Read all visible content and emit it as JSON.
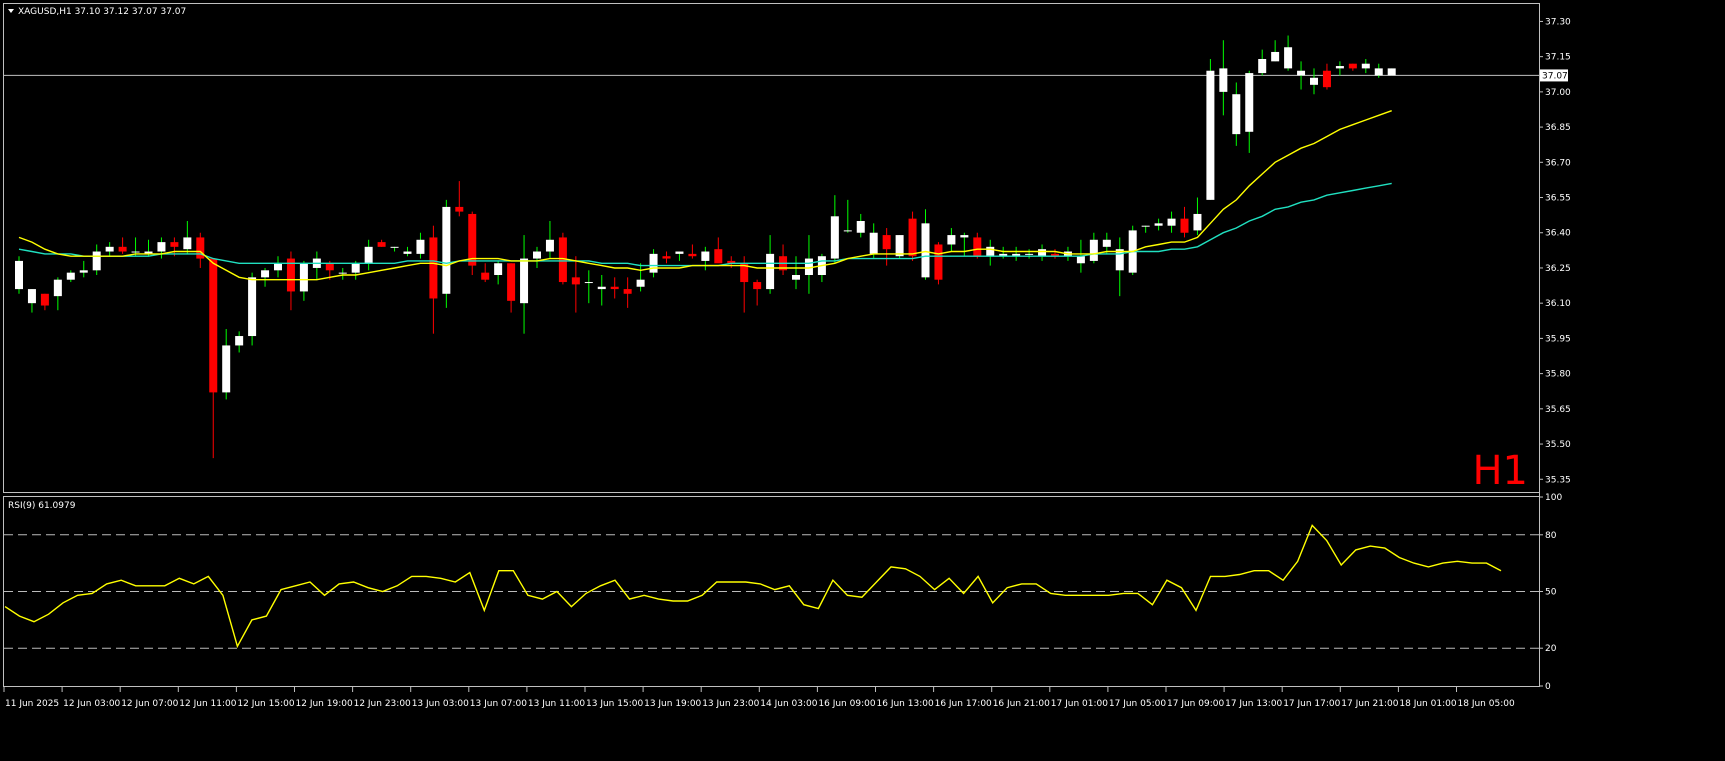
{
  "header": {
    "symbol_line": "XAGUSD,H1  37.10 37.12 37.07 37.07",
    "timeframe_watermark": "H1"
  },
  "rsi_panel": {
    "label": "RSI(9) 61.0979"
  },
  "colors": {
    "background": "#000000",
    "frame": "#c0c0c0",
    "bull_candle": "#ffffff",
    "bear_candle": "#ff0000",
    "wick_bull": "#00ff00",
    "wick_bear": "#ff0000",
    "ma_fast": "#ffff00",
    "ma_slow": "#20e0c0",
    "rsi_line": "#ffff00",
    "watermark": "#ff0000",
    "price_line": "#c0c0c0"
  },
  "chart_data": [
    {
      "type": "candlestick",
      "symbol": "XAGUSD",
      "timeframe": "H1",
      "last_price": 37.07,
      "last_price_label": "37.07",
      "y_ticks": [
        "37.30",
        "37.15",
        "37.00",
        "36.85",
        "36.70",
        "36.55",
        "36.40",
        "36.25",
        "36.10",
        "35.95",
        "35.80",
        "35.65",
        "35.50",
        "35.35"
      ],
      "ylim": [
        35.3,
        37.37
      ],
      "x_tick_labels": [
        "11 Jun 2025",
        "12 Jun 03:00",
        "12 Jun 07:00",
        "12 Jun 11:00",
        "12 Jun 15:00",
        "12 Jun 19:00",
        "12 Jun 23:00",
        "13 Jun 03:00",
        "13 Jun 07:00",
        "13 Jun 11:00",
        "13 Jun 15:00",
        "13 Jun 19:00",
        "13 Jun 23:00",
        "14 Jun 03:00",
        "16 Jun 09:00",
        "16 Jun 13:00",
        "16 Jun 17:00",
        "16 Jun 21:00",
        "17 Jun 01:00",
        "17 Jun 05:00",
        "17 Jun 09:00",
        "17 Jun 13:00",
        "17 Jun 17:00",
        "17 Jun 21:00",
        "18 Jun 01:00",
        "18 Jun 05:00"
      ],
      "ohlc": [
        [
          36.16,
          36.3,
          36.14,
          36.28
        ],
        [
          36.1,
          36.16,
          36.06,
          36.16
        ],
        [
          36.14,
          36.14,
          36.07,
          36.09
        ],
        [
          36.13,
          36.21,
          36.07,
          36.2
        ],
        [
          36.2,
          36.24,
          36.19,
          36.23
        ],
        [
          36.23,
          36.28,
          36.21,
          36.24
        ],
        [
          36.24,
          36.35,
          36.22,
          36.32
        ],
        [
          36.32,
          36.36,
          36.3,
          36.34
        ],
        [
          36.34,
          36.38,
          36.31,
          36.32
        ],
        [
          36.32,
          36.38,
          36.3,
          36.32
        ],
        [
          36.31,
          36.37,
          36.3,
          36.32
        ],
        [
          36.32,
          36.38,
          36.29,
          36.36
        ],
        [
          36.36,
          36.38,
          36.3,
          36.34
        ],
        [
          36.33,
          36.45,
          36.31,
          36.38
        ],
        [
          36.38,
          36.4,
          36.25,
          36.29
        ],
        [
          36.29,
          36.29,
          35.44,
          35.72
        ],
        [
          35.72,
          35.99,
          35.69,
          35.92
        ],
        [
          35.92,
          35.98,
          35.89,
          35.96
        ],
        [
          35.96,
          36.23,
          35.92,
          36.21
        ],
        [
          36.21,
          36.25,
          36.17,
          36.24
        ],
        [
          36.24,
          36.3,
          36.21,
          36.27
        ],
        [
          36.29,
          36.32,
          36.07,
          36.15
        ],
        [
          36.15,
          36.28,
          36.11,
          36.27
        ],
        [
          36.25,
          36.32,
          36.2,
          36.29
        ],
        [
          36.27,
          36.28,
          36.2,
          36.24
        ],
        [
          36.23,
          36.25,
          36.2,
          36.23
        ],
        [
          36.23,
          36.28,
          36.2,
          36.27
        ],
        [
          36.27,
          36.37,
          36.24,
          36.34
        ],
        [
          36.36,
          36.37,
          36.34,
          36.34
        ],
        [
          36.34,
          36.34,
          36.32,
          36.34
        ],
        [
          36.31,
          36.34,
          36.3,
          36.32
        ],
        [
          36.31,
          36.4,
          36.29,
          36.37
        ],
        [
          36.38,
          36.43,
          35.97,
          36.12
        ],
        [
          36.14,
          36.54,
          36.08,
          36.51
        ],
        [
          36.51,
          36.62,
          36.47,
          36.49
        ],
        [
          36.48,
          36.49,
          36.22,
          36.26
        ],
        [
          36.23,
          36.27,
          36.19,
          36.2
        ],
        [
          36.22,
          36.28,
          36.18,
          36.27
        ],
        [
          36.27,
          36.27,
          36.06,
          36.11
        ],
        [
          36.1,
          36.39,
          35.97,
          36.29
        ],
        [
          36.29,
          36.34,
          36.25,
          36.32
        ],
        [
          36.32,
          36.45,
          36.29,
          36.37
        ],
        [
          36.38,
          36.4,
          36.18,
          36.19
        ],
        [
          36.21,
          36.3,
          36.06,
          36.18
        ],
        [
          36.19,
          36.24,
          36.1,
          36.19
        ],
        [
          36.16,
          36.22,
          36.09,
          36.17
        ],
        [
          36.17,
          36.21,
          36.12,
          36.16
        ],
        [
          36.16,
          36.21,
          36.08,
          36.14
        ],
        [
          36.17,
          36.27,
          36.15,
          36.2
        ],
        [
          36.23,
          36.33,
          36.21,
          36.31
        ],
        [
          36.3,
          36.32,
          36.27,
          36.29
        ],
        [
          36.31,
          36.32,
          36.28,
          36.32
        ],
        [
          36.31,
          36.35,
          36.29,
          36.3
        ],
        [
          36.28,
          36.34,
          36.24,
          36.32
        ],
        [
          36.33,
          36.38,
          36.28,
          36.27
        ],
        [
          36.28,
          36.3,
          36.25,
          36.27
        ],
        [
          36.27,
          36.3,
          36.06,
          36.19
        ],
        [
          36.19,
          36.2,
          36.09,
          36.16
        ],
        [
          36.16,
          36.39,
          36.14,
          36.31
        ],
        [
          36.3,
          36.35,
          36.22,
          36.24
        ],
        [
          36.2,
          36.3,
          36.16,
          36.22
        ],
        [
          36.22,
          36.39,
          36.14,
          36.29
        ],
        [
          36.22,
          36.31,
          36.19,
          36.3
        ],
        [
          36.29,
          36.56,
          36.27,
          36.47
        ],
        [
          36.41,
          36.54,
          36.4,
          36.41
        ],
        [
          36.4,
          36.48,
          36.38,
          36.45
        ],
        [
          36.31,
          36.44,
          36.29,
          36.4
        ],
        [
          36.39,
          36.42,
          36.26,
          36.33
        ],
        [
          36.3,
          36.39,
          36.29,
          36.39
        ],
        [
          36.46,
          36.49,
          36.28,
          36.3
        ],
        [
          36.21,
          36.5,
          36.2,
          36.44
        ],
        [
          36.35,
          36.36,
          36.18,
          36.2
        ],
        [
          36.35,
          36.42,
          36.32,
          36.39
        ],
        [
          36.38,
          36.4,
          36.3,
          36.39
        ],
        [
          36.38,
          36.4,
          36.29,
          36.3
        ],
        [
          36.3,
          36.37,
          36.26,
          36.34
        ],
        [
          36.3,
          36.34,
          36.29,
          36.31
        ],
        [
          36.3,
          36.34,
          36.28,
          36.31
        ],
        [
          36.31,
          36.33,
          36.29,
          36.31
        ],
        [
          36.3,
          36.35,
          36.28,
          36.33
        ],
        [
          36.31,
          36.33,
          36.29,
          36.3
        ],
        [
          36.3,
          36.34,
          36.28,
          36.32
        ],
        [
          36.27,
          36.37,
          36.23,
          36.3
        ],
        [
          36.28,
          36.4,
          36.27,
          36.37
        ],
        [
          36.34,
          36.4,
          36.31,
          36.37
        ],
        [
          36.24,
          36.38,
          36.13,
          36.33
        ],
        [
          36.23,
          36.43,
          36.22,
          36.41
        ],
        [
          36.43,
          36.43,
          36.4,
          36.43
        ],
        [
          36.43,
          36.46,
          36.41,
          36.44
        ],
        [
          36.43,
          36.49,
          36.4,
          36.46
        ],
        [
          36.46,
          36.51,
          36.38,
          36.4
        ],
        [
          36.41,
          36.55,
          36.39,
          36.48
        ],
        [
          36.54,
          37.14,
          36.54,
          37.09
        ],
        [
          37.0,
          37.22,
          36.9,
          37.1
        ],
        [
          36.82,
          37.04,
          36.77,
          36.99
        ],
        [
          36.83,
          37.09,
          36.74,
          37.08
        ],
        [
          37.08,
          37.18,
          37.07,
          37.14
        ],
        [
          37.13,
          37.22,
          37.13,
          37.17
        ],
        [
          37.1,
          37.24,
          37.09,
          37.19
        ],
        [
          37.07,
          37.13,
          37.01,
          37.09
        ],
        [
          37.03,
          37.1,
          36.99,
          37.06
        ],
        [
          37.09,
          37.12,
          37.01,
          37.02
        ],
        [
          37.1,
          37.13,
          37.07,
          37.11
        ],
        [
          37.12,
          37.12,
          37.09,
          37.1
        ],
        [
          37.1,
          37.14,
          37.08,
          37.12
        ],
        [
          37.07,
          37.12,
          37.06,
          37.1
        ],
        [
          37.07,
          37.1,
          37.07,
          37.1
        ]
      ],
      "ma_fast": [
        36.38,
        36.36,
        36.33,
        36.31,
        36.3,
        36.3,
        36.3,
        36.3,
        36.3,
        36.31,
        36.31,
        36.31,
        36.32,
        36.32,
        36.32,
        36.27,
        36.24,
        36.21,
        36.2,
        36.2,
        36.2,
        36.2,
        36.2,
        36.2,
        36.21,
        36.22,
        36.22,
        36.23,
        36.24,
        36.25,
        36.26,
        36.27,
        36.27,
        36.26,
        36.28,
        36.29,
        36.29,
        36.29,
        36.28,
        36.28,
        36.28,
        36.29,
        36.29,
        36.28,
        36.27,
        36.26,
        36.25,
        36.25,
        36.24,
        36.25,
        36.25,
        36.25,
        36.26,
        36.26,
        36.26,
        36.26,
        36.26,
        36.25,
        36.25,
        36.25,
        36.25,
        36.25,
        36.26,
        36.27,
        36.29,
        36.3,
        36.31,
        36.31,
        36.31,
        36.31,
        36.32,
        36.31,
        36.32,
        36.32,
        36.33,
        36.33,
        36.32,
        36.32,
        36.32,
        36.32,
        36.32,
        36.31,
        36.31,
        36.31,
        36.32,
        36.32,
        36.32,
        36.34,
        36.35,
        36.36,
        36.36,
        36.38,
        36.44,
        36.5,
        36.54,
        36.6,
        36.65,
        36.7,
        36.73,
        36.76,
        36.78,
        36.81,
        36.84,
        36.86,
        36.88,
        36.9,
        36.92
      ],
      "ma_slow": [
        36.33,
        36.32,
        36.31,
        36.31,
        36.31,
        36.3,
        36.3,
        36.3,
        36.3,
        36.3,
        36.3,
        36.31,
        36.31,
        36.31,
        36.31,
        36.29,
        36.28,
        36.27,
        36.27,
        36.27,
        36.27,
        36.27,
        36.27,
        36.27,
        36.27,
        36.27,
        36.27,
        36.27,
        36.27,
        36.27,
        36.28,
        36.28,
        36.28,
        36.27,
        36.28,
        36.28,
        36.28,
        36.28,
        36.28,
        36.28,
        36.28,
        36.28,
        36.28,
        36.28,
        36.28,
        36.27,
        36.27,
        36.27,
        36.26,
        36.26,
        36.26,
        36.26,
        36.26,
        36.26,
        36.26,
        36.27,
        36.27,
        36.27,
        36.27,
        36.27,
        36.27,
        36.27,
        36.28,
        36.28,
        36.29,
        36.29,
        36.29,
        36.29,
        36.29,
        36.29,
        36.3,
        36.3,
        36.3,
        36.3,
        36.3,
        36.3,
        36.3,
        36.3,
        36.3,
        36.3,
        36.3,
        36.3,
        36.3,
        36.31,
        36.31,
        36.31,
        36.32,
        36.32,
        36.32,
        36.33,
        36.33,
        36.34,
        36.37,
        36.4,
        36.42,
        36.45,
        36.47,
        36.5,
        36.51,
        36.53,
        36.54,
        36.56,
        36.57,
        36.58,
        36.59,
        36.6,
        36.61
      ]
    },
    {
      "type": "line",
      "name": "RSI(9)",
      "ylim": [
        0,
        100
      ],
      "y_ticks": [
        "100",
        "80",
        "50",
        "20",
        "0"
      ],
      "levels": [
        80,
        50,
        20
      ],
      "values": [
        42,
        37,
        34,
        38,
        44,
        48,
        49,
        54,
        56,
        53,
        53,
        53,
        57,
        54,
        58,
        48,
        21,
        35,
        37,
        51,
        53,
        55,
        48,
        54,
        55,
        52,
        50,
        53,
        58,
        58,
        57,
        55,
        60,
        40,
        61,
        61,
        48,
        46,
        50,
        42,
        49,
        53,
        56,
        46,
        48,
        46,
        45,
        45,
        48,
        55,
        55,
        55,
        54,
        51,
        53,
        43,
        41,
        56,
        48,
        47,
        55,
        63,
        62,
        58,
        51,
        57,
        49,
        58,
        44,
        52,
        54,
        54,
        49,
        48,
        48,
        48,
        48,
        49,
        49,
        43,
        56,
        52,
        40,
        58,
        58,
        59,
        61,
        61,
        56,
        66,
        85,
        77,
        64,
        72,
        74,
        73,
        68,
        65,
        63,
        65,
        66,
        65,
        65,
        61
      ]
    }
  ]
}
